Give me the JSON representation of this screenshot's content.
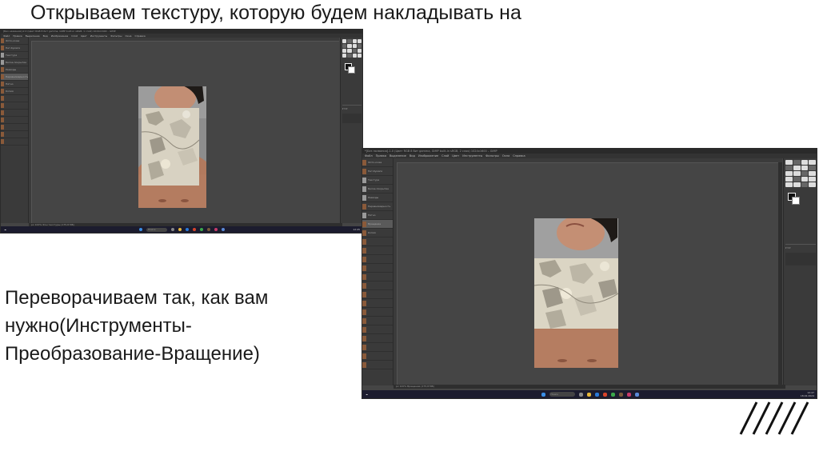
{
  "slide": {
    "title": "Открываем текстуру, которую будем накладывать на",
    "body_lines": [
      "Переворачиваем так, как вам",
      "нужно(Инструменты-",
      "Преобразование-Вращение)"
    ]
  },
  "screenshots": [
    {
      "window_title": "[Без названия]-2.0 (Цвет RGB 8 бит gamma, GIMP built-in sRGB, 1 слой) 1024x1600 – GIMP",
      "menu": [
        "Файл",
        "Правка",
        "Выделение",
        "Вид",
        "Изображение",
        "Слой",
        "Цвет",
        "Инструменты",
        "Фильтры",
        "Окна",
        "Справка"
      ],
      "layers": [
        "Фото-кожа",
        "Нет-бумаги",
        "Текстура",
        "Белое-покрытие",
        "Разводы",
        "Неравномерность",
        "Пятно",
        "Копия"
      ],
      "status": "px  100%  Фон текстуры (175,8 МБ)",
      "taskbar": {
        "search": "Поиск",
        "time": "12:45",
        "date": "18.02.2024"
      },
      "colors": {
        "workspace": "#454545",
        "panel": "#3a3a3a",
        "taskbar": "#1c1c2e"
      }
    },
    {
      "window_title": "*[Без названия]-1.0 (Цвет RGB 8 бит gamma, GIMP built-in sRGB, 2 слоя) 1024x1600 – GIMP",
      "menu": [
        "Файл",
        "Правка",
        "Выделение",
        "Вид",
        "Изображение",
        "Слой",
        "Цвет",
        "Инструменты",
        "Фильтры",
        "Окна",
        "Справка"
      ],
      "layers": [
        "Фото-кожа",
        "Нет-бумаги",
        "Текстура",
        "Белое-покрытие",
        "Разводы",
        "Неравномерность",
        "Пятно",
        "Копия",
        "Вращение"
      ],
      "status": "px  100%  Вращение (175,8 МБ)",
      "taskbar": {
        "search": "Поиск",
        "time": "12:47",
        "date": "18.02.2024"
      },
      "colors": {
        "workspace": "#454545",
        "panel": "#3a3a3a",
        "taskbar": "#1c1c2e"
      }
    }
  ]
}
